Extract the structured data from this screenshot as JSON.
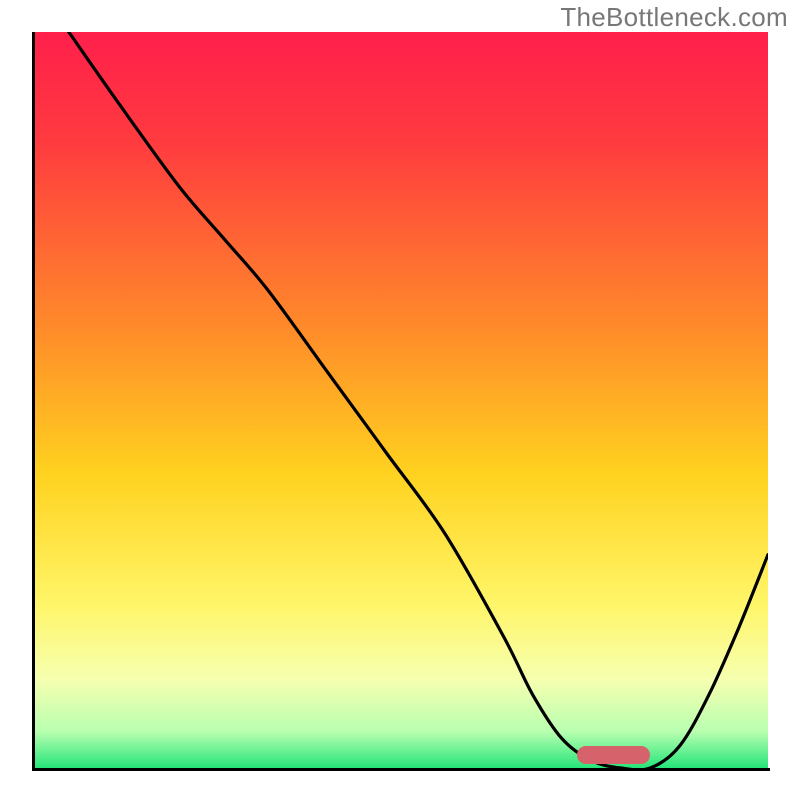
{
  "watermark": "TheBottleneck.com",
  "chart_data": {
    "type": "line",
    "title": "",
    "xlabel": "",
    "ylabel": "",
    "xlim": [
      0,
      100
    ],
    "ylim": [
      0,
      100
    ],
    "gradient_stops": [
      {
        "offset": 0,
        "color": "#ff1f4b"
      },
      {
        "offset": 15,
        "color": "#ff3b3f"
      },
      {
        "offset": 40,
        "color": "#ff8a2a"
      },
      {
        "offset": 60,
        "color": "#ffd21f"
      },
      {
        "offset": 78,
        "color": "#fff66a"
      },
      {
        "offset": 88,
        "color": "#f6ffb0"
      },
      {
        "offset": 95,
        "color": "#b9ffb0"
      },
      {
        "offset": 100,
        "color": "#26e57a"
      }
    ],
    "series": [
      {
        "name": "bottleneck-curve",
        "x": [
          5,
          12,
          20,
          26,
          32,
          40,
          48,
          56,
          64,
          68,
          72,
          76,
          80,
          84,
          88,
          92,
          96,
          100
        ],
        "y": [
          100,
          90,
          79,
          72,
          65,
          54,
          43,
          32,
          18,
          10,
          4,
          1,
          0,
          0,
          3,
          10,
          19,
          29
        ]
      }
    ],
    "optimum_range_x": [
      74,
      84
    ],
    "marker_color": "#d6636b"
  }
}
